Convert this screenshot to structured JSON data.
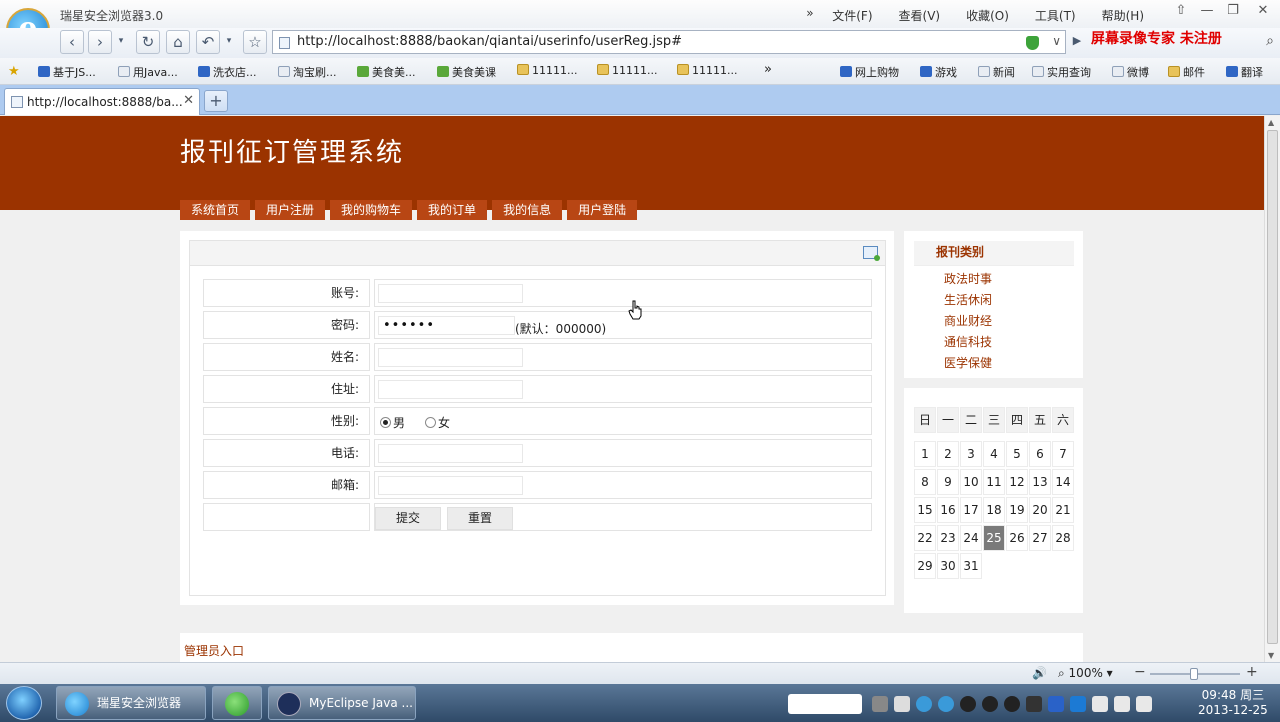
{
  "browser": {
    "app_title": "瑞星安全浏览器3.0",
    "logo_glyph": "e",
    "menu": [
      "文件(F)",
      "查看(V)",
      "收藏(O)",
      "工具(T)",
      "帮助(H)"
    ],
    "menu_more": "»",
    "url": "http://localhost:8888/baokan/qiantai/userinfo/userReg.jsp#",
    "watermark": "屏幕录像专家  未注册",
    "favorites": [
      {
        "label": "基于JS...",
        "kind": "blue"
      },
      {
        "label": "用Java...",
        "kind": "page"
      },
      {
        "label": "洗衣店...",
        "kind": "blue"
      },
      {
        "label": "淘宝刷...",
        "kind": "page"
      },
      {
        "label": "美食美...",
        "kind": "green"
      },
      {
        "label": "美食美课",
        "kind": "green"
      },
      {
        "label": "11111...",
        "kind": "folder"
      },
      {
        "label": "11111...",
        "kind": "folder"
      },
      {
        "label": "11111...",
        "kind": "folder"
      }
    ],
    "fav_more": "»",
    "quick_links": [
      "网上购物",
      "游戏",
      "新闻",
      "实用查询",
      "微博",
      "邮件",
      "翻译"
    ],
    "tab_label": "http://localhost:8888/ba...",
    "zoom": "100%"
  },
  "site": {
    "title": "报刊征订管理系统",
    "nav": [
      "系统首页",
      "用户注册",
      "我的购物车",
      "我的订单",
      "我的信息",
      "用户登陆"
    ]
  },
  "form": {
    "account_label": "账号:",
    "password_label": "密码:",
    "password_value": "••••••",
    "password_hint": "(默认：000000)",
    "name_label": "姓名:",
    "address_label": "住址:",
    "gender_label": "性别:",
    "gender_male": "男",
    "gender_female": "女",
    "gender_selected": "男",
    "phone_label": "电话:",
    "email_label": "邮箱:",
    "submit_label": "提交",
    "reset_label": "重置"
  },
  "categories": {
    "title": "报刊类别",
    "items": [
      "政法时事",
      "生活休闲",
      "商业财经",
      "通信科技",
      "医学保健"
    ]
  },
  "calendar": {
    "weekdays": [
      "日",
      "一",
      "二",
      "三",
      "四",
      "五",
      "六"
    ],
    "days": [
      1,
      2,
      3,
      4,
      5,
      6,
      7,
      8,
      9,
      10,
      11,
      12,
      13,
      14,
      15,
      16,
      17,
      18,
      19,
      20,
      21,
      22,
      23,
      24,
      25,
      26,
      27,
      28,
      29,
      30,
      31
    ],
    "start_weekday": 0,
    "today": 25
  },
  "footer": {
    "admin_link": "管理员入口"
  },
  "taskbar": {
    "tasks": [
      "瑞星安全浏览器",
      "",
      "MyEclipse Java ..."
    ],
    "time": "09:48 周三",
    "date": "2013-12-25"
  }
}
